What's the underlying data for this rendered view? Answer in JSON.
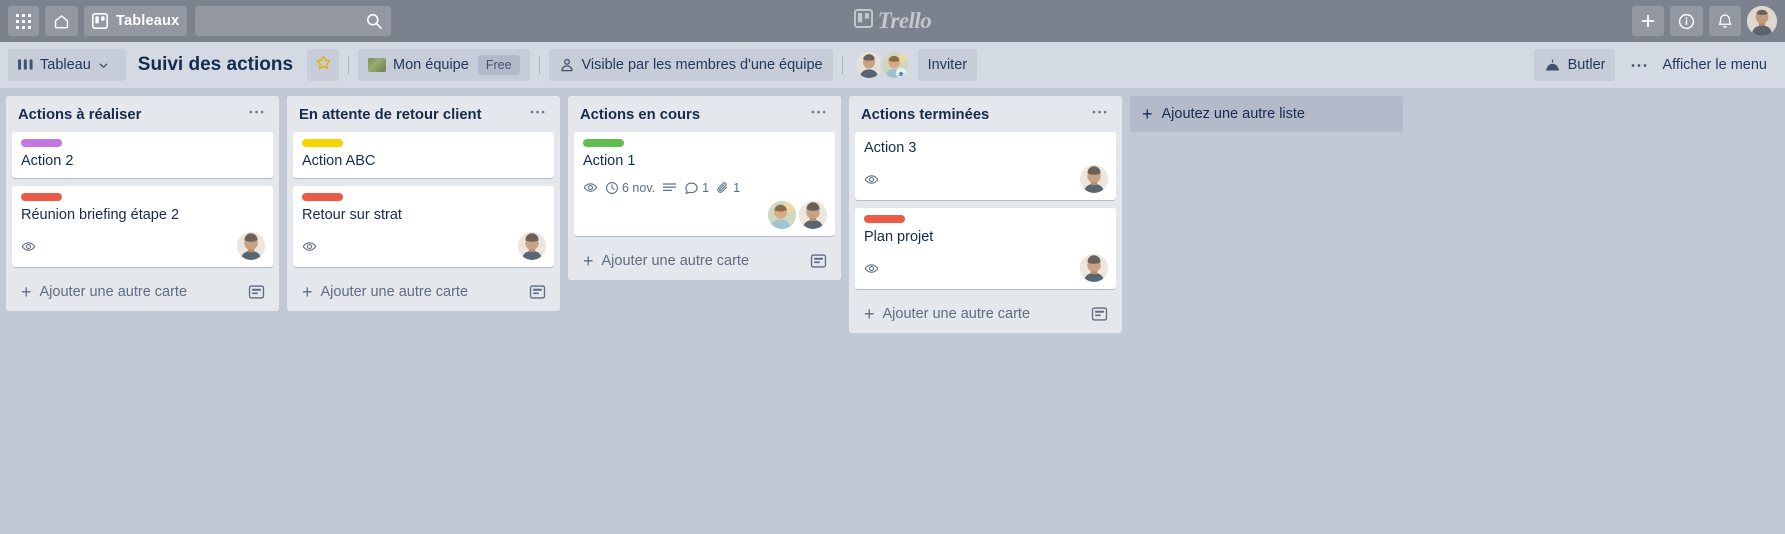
{
  "topnav": {
    "apps_icon": "grid-apps-icon",
    "home_icon": "home-icon",
    "boards_icon": "board-icon",
    "boards_label": "Tableaux",
    "search_placeholder": "",
    "search_value": "",
    "search_icon": "search-icon",
    "brand_label": "Trello",
    "brand_icon": "trello-logo-icon",
    "add_icon": "plus-icon",
    "info_icon": "info-circle-icon",
    "notifications_icon": "bell-icon",
    "user_avatar": "user-avatar"
  },
  "board_header": {
    "board_button_label": "Tableau",
    "board_button_icon": "board-icon",
    "board_button_chevron": "chevron-down-icon",
    "title": "Suivi des actions",
    "star_icon": "star-icon",
    "team_label": "Mon équipe",
    "team_icon": "team-thumbnail-icon",
    "plan_badge": "Free",
    "visibility_label": "Visible par les membres d'une équipe",
    "visibility_icon": "team-visibility-icon",
    "invite_label": "Inviter",
    "butler_label": "Butler",
    "butler_icon": "butler-robot-icon",
    "menu_label": "Afficher le menu",
    "menu_icon": "ellipsis-icon",
    "members": [
      "member-avatar-1",
      "member-avatar-2"
    ]
  },
  "colors": {
    "label_purple": "#c377e0",
    "label_red": "#eb5a46",
    "label_yellow": "#f2d600",
    "label_green": "#61bd4f",
    "board_background": "#c2c9d6",
    "list_background": "#e4e7ec",
    "card_background": "#ffffff",
    "topnav_background": "#7b818d",
    "header_background": "#d4dae4",
    "text_primary": "#172b4d",
    "text_muted": "#5e6c84"
  },
  "add_list": {
    "label": "Ajoutez une autre liste",
    "plus": "+"
  },
  "add_card_label": "Ajouter une autre carte",
  "lists": [
    {
      "title": "Actions à réaliser",
      "menu_icon": "list-menu-icon",
      "add_card_label": "Ajouter une autre carte",
      "template_icon": "card-template-icon",
      "cards": [
        {
          "title": "Action 2",
          "labels": [
            "#c377e0"
          ],
          "badges": [],
          "members": []
        },
        {
          "title": "Réunion briefing étape 2",
          "labels": [
            "#eb5a46"
          ],
          "badges": [
            {
              "type": "watch",
              "icon": "eye-icon",
              "text": ""
            }
          ],
          "members": [
            "member-avatar-1"
          ]
        }
      ]
    },
    {
      "title": "En attente de retour client",
      "menu_icon": "list-menu-icon",
      "add_card_label": "Ajouter une autre carte",
      "template_icon": "card-template-icon",
      "cards": [
        {
          "title": "Action ABC",
          "labels": [
            "#f2d600"
          ],
          "badges": [],
          "members": []
        },
        {
          "title": "Retour sur strat",
          "labels": [
            "#eb5a46"
          ],
          "badges": [
            {
              "type": "watch",
              "icon": "eye-icon",
              "text": ""
            }
          ],
          "members": [
            "member-avatar-1"
          ]
        }
      ]
    },
    {
      "title": "Actions en cours",
      "menu_icon": "list-menu-icon",
      "add_card_label": "Ajouter une autre carte",
      "template_icon": "card-template-icon",
      "cards": [
        {
          "title": "Action 1",
          "labels": [
            "#61bd4f"
          ],
          "badges": [
            {
              "type": "watch",
              "icon": "eye-icon",
              "text": ""
            },
            {
              "type": "due-date",
              "icon": "clock-icon",
              "text": "6 nov."
            },
            {
              "type": "description",
              "icon": "description-icon",
              "text": ""
            },
            {
              "type": "comments",
              "icon": "comment-icon",
              "text": "1"
            },
            {
              "type": "attachments",
              "icon": "paperclip-icon",
              "text": "1"
            }
          ],
          "members": [
            "member-avatar-2",
            "member-avatar-1"
          ]
        }
      ]
    },
    {
      "title": "Actions terminées",
      "menu_icon": "list-menu-icon",
      "add_card_label": "Ajouter une autre carte",
      "template_icon": "card-template-icon",
      "cards": [
        {
          "title": "Action 3",
          "labels": [],
          "badges": [
            {
              "type": "watch",
              "icon": "eye-icon",
              "text": ""
            }
          ],
          "members": [
            "member-avatar-1"
          ]
        },
        {
          "title": "Plan projet",
          "labels": [
            "#eb5a46"
          ],
          "badges": [
            {
              "type": "watch",
              "icon": "eye-icon",
              "text": ""
            }
          ],
          "members": [
            "member-avatar-1"
          ]
        }
      ]
    }
  ]
}
